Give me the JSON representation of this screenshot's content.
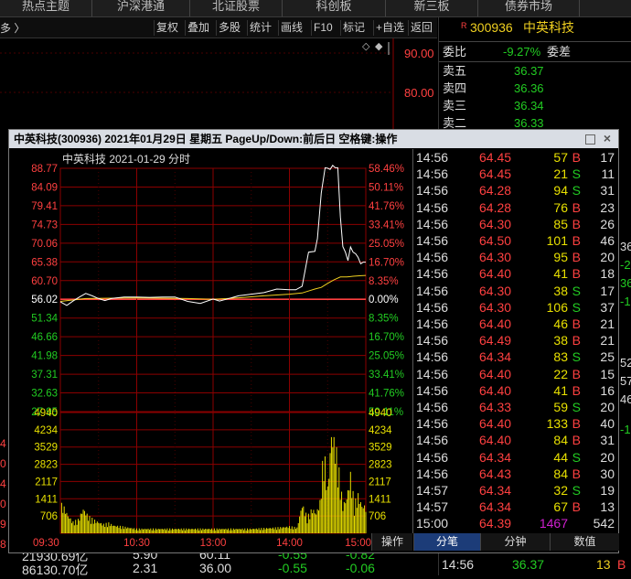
{
  "top_tabs": [
    "热点主题",
    "沪深港通",
    "北证股票",
    "科创板",
    "新三板",
    "债券市场"
  ],
  "toolbar": {
    "more": "多 〉",
    "buttons": [
      "复权",
      "叠加",
      "多股",
      "统计",
      "画线",
      "F10",
      "标记",
      "+自选",
      "返回"
    ]
  },
  "quote_panel": {
    "badge": "R",
    "code": "300936",
    "name": "中英科技",
    "price_axis": [
      "90.00",
      "80.00"
    ],
    "wb_label": "委比",
    "wb_value": "-9.27%",
    "wc_label": "委差",
    "asks": [
      {
        "label": "卖五",
        "price": "36.37"
      },
      {
        "label": "卖四",
        "price": "36.36"
      },
      {
        "label": "卖三",
        "price": "36.34"
      },
      {
        "label": "卖二",
        "price": "36.33"
      }
    ],
    "side_values": [
      "36",
      "-2",
      "36",
      "-1",
      "52",
      "57",
      "46",
      "-1"
    ],
    "bottom_row": {
      "time": "14:56",
      "price": "36.37",
      "vol": "13",
      "side": "B"
    }
  },
  "bottom_strip": {
    "row1": [
      "21930.69亿",
      "5.90",
      "60.11",
      "-0.55",
      "-0.82"
    ],
    "row2": [
      "86130.70亿",
      "2.31",
      "36.00",
      "-0.55",
      "-0.06"
    ],
    "left_marks": [
      "4",
      "0",
      "4",
      "0",
      "9",
      "8",
      "3",
      "9"
    ]
  },
  "dialog": {
    "title": "中英科技(300936)  2021年01月29日 星期五  PageUp/Down:前后日  空格键:操作",
    "chart_header": "中英科技  2021-01-29  分时",
    "operate_label": "操作",
    "tabs": [
      "分笔",
      "分钟",
      "数值"
    ]
  },
  "chart_data": {
    "type": "line",
    "title": "中英科技  2021-01-29  分时",
    "pre_close": 56.02,
    "ylim": [
      27.95,
      88.77
    ],
    "price_ticks_up": [
      "88.77",
      "84.09",
      "79.41",
      "74.73",
      "70.06",
      "65.38",
      "60.70"
    ],
    "price_tick_mid": "56.02",
    "price_ticks_down": [
      "51.34",
      "46.66",
      "41.98",
      "37.31",
      "32.63",
      "27.95"
    ],
    "pct_ticks_up": [
      "58.46%",
      "50.11%",
      "41.76%",
      "33.41%",
      "25.05%",
      "16.70%",
      "8.35%"
    ],
    "pct_tick_mid": "0.00%",
    "pct_ticks_down": [
      "8.35%",
      "16.70%",
      "25.05%",
      "33.41%",
      "41.76%",
      "50.11%"
    ],
    "volume_ticks": [
      "4940",
      "4234",
      "3529",
      "2823",
      "2117",
      "1411",
      "706"
    ],
    "volume_max": 4940,
    "time_labels": [
      "09:30",
      "10:30",
      "13:00",
      "14:00",
      "15:00"
    ],
    "price_series": {
      "x": [
        0,
        5,
        10,
        15,
        20,
        25,
        30,
        35,
        40,
        50,
        60,
        70,
        80,
        90,
        100,
        110,
        120,
        125,
        130,
        140,
        150,
        160,
        170,
        180,
        185,
        190,
        195,
        200,
        202,
        205,
        208,
        210,
        212,
        214,
        216,
        218,
        220,
        222,
        224,
        226,
        228,
        230,
        232,
        234,
        236,
        238,
        240
      ],
      "values": [
        55.4,
        54.5,
        55.6,
        56.6,
        57.5,
        56.9,
        56.2,
        55.7,
        56.2,
        56.6,
        56.6,
        56.5,
        56.6,
        56.6,
        55.5,
        55.0,
        56.1,
        55.6,
        56.0,
        56.9,
        57.3,
        57.7,
        58.6,
        58.4,
        58.4,
        59.3,
        67.8,
        68.0,
        71.2,
        82.6,
        88.9,
        88.8,
        88.5,
        89.5,
        88.9,
        88.9,
        76.6,
        69.2,
        67.8,
        65.7,
        69.1,
        67.8,
        67.4,
        66.5,
        64.9,
        65.3,
        65.3
      ]
    },
    "avg_series": {
      "x": [
        0,
        20,
        40,
        60,
        80,
        100,
        120,
        140,
        160,
        180,
        190,
        196,
        200,
        205,
        210,
        215,
        220,
        225,
        230,
        235,
        240
      ],
      "values": [
        55.5,
        56.2,
        56.3,
        56.4,
        56.3,
        56.2,
        56.0,
        56.4,
        56.9,
        57.3,
        57.6,
        58.2,
        58.6,
        59.0,
        60.0,
        60.9,
        61.6,
        61.6,
        61.8,
        61.9,
        62.0
      ]
    },
    "volume_series": {
      "x": [
        2,
        6,
        10,
        14,
        18,
        22,
        26,
        30,
        34,
        38,
        42,
        60,
        90,
        120,
        150,
        170,
        180,
        186,
        190,
        194,
        198,
        201,
        204,
        207,
        210,
        213,
        216,
        219,
        222,
        225,
        228,
        231,
        234,
        237,
        240
      ],
      "values": [
        1250,
        800,
        500,
        600,
        1100,
        750,
        600,
        500,
        400,
        450,
        350,
        200,
        200,
        200,
        200,
        250,
        300,
        250,
        1300,
        700,
        1100,
        900,
        1400,
        3750,
        2000,
        4480,
        4000,
        2700,
        1250,
        1600,
        2600,
        1300,
        1700,
        1250,
        1200
      ]
    }
  },
  "ticks": [
    {
      "t": "14:56",
      "p": "64.45",
      "v": "57",
      "s": "B",
      "n": "17"
    },
    {
      "t": "14:56",
      "p": "64.45",
      "v": "21",
      "s": "S",
      "n": "11"
    },
    {
      "t": "14:56",
      "p": "64.28",
      "v": "94",
      "s": "S",
      "n": "31"
    },
    {
      "t": "14:56",
      "p": "64.28",
      "v": "76",
      "s": "B",
      "n": "23"
    },
    {
      "t": "14:56",
      "p": "64.30",
      "v": "85",
      "s": "B",
      "n": "26"
    },
    {
      "t": "14:56",
      "p": "64.50",
      "v": "101",
      "s": "B",
      "n": "46"
    },
    {
      "t": "14:56",
      "p": "64.30",
      "v": "95",
      "s": "B",
      "n": "20"
    },
    {
      "t": "14:56",
      "p": "64.40",
      "v": "41",
      "s": "B",
      "n": "18"
    },
    {
      "t": "14:56",
      "p": "64.30",
      "v": "38",
      "s": "S",
      "n": "17"
    },
    {
      "t": "14:56",
      "p": "64.30",
      "v": "106",
      "s": "S",
      "n": "37"
    },
    {
      "t": "14:56",
      "p": "64.40",
      "v": "46",
      "s": "B",
      "n": "21"
    },
    {
      "t": "14:56",
      "p": "64.49",
      "v": "38",
      "s": "B",
      "n": "21"
    },
    {
      "t": "14:56",
      "p": "64.34",
      "v": "83",
      "s": "S",
      "n": "25"
    },
    {
      "t": "14:56",
      "p": "64.40",
      "v": "22",
      "s": "B",
      "n": "15"
    },
    {
      "t": "14:56",
      "p": "64.40",
      "v": "41",
      "s": "B",
      "n": "16"
    },
    {
      "t": "14:56",
      "p": "64.33",
      "v": "59",
      "s": "S",
      "n": "20"
    },
    {
      "t": "14:56",
      "p": "64.40",
      "v": "133",
      "s": "B",
      "n": "40"
    },
    {
      "t": "14:56",
      "p": "64.40",
      "v": "84",
      "s": "B",
      "n": "31"
    },
    {
      "t": "14:56",
      "p": "64.34",
      "v": "44",
      "s": "S",
      "n": "20"
    },
    {
      "t": "14:56",
      "p": "64.43",
      "v": "84",
      "s": "B",
      "n": "30"
    },
    {
      "t": "14:57",
      "p": "64.34",
      "v": "32",
      "s": "S",
      "n": "19"
    },
    {
      "t": "14:57",
      "p": "64.34",
      "v": "67",
      "s": "B",
      "n": "13"
    },
    {
      "t": "15:00",
      "p": "64.39",
      "v": "1467",
      "s": "",
      "n": "542"
    }
  ],
  "colors": {
    "up": "#ff4040",
    "down": "#22cc22",
    "grid_red": "#8b0000",
    "price_line": "#ffffff",
    "avg_line": "#f0d020",
    "volume": "#e8e000",
    "special_vol": "#d020d0",
    "tab_active": "#1c3c78"
  }
}
